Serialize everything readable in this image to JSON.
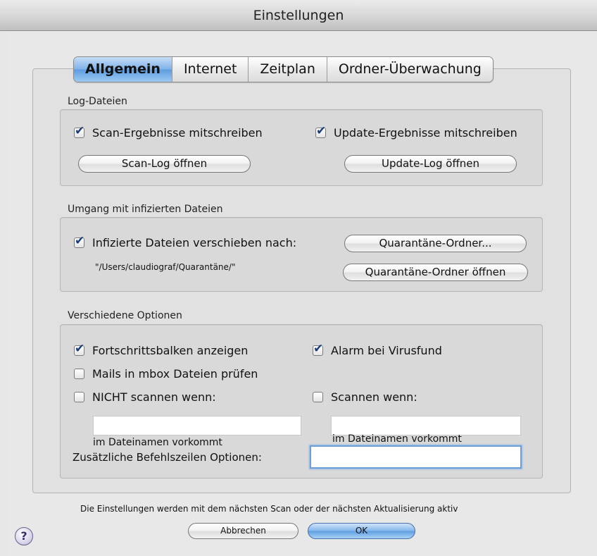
{
  "window": {
    "title": "Einstellungen"
  },
  "tabs": [
    {
      "label": "Allgemein",
      "selected": true
    },
    {
      "label": "Internet",
      "selected": false
    },
    {
      "label": "Zeitplan",
      "selected": false
    },
    {
      "label": "Ordner-Überwachung",
      "selected": false
    }
  ],
  "log": {
    "group_label": "Log-Dateien",
    "scan_results": {
      "label": "Scan-Ergebnisse mitschreiben",
      "checked": true
    },
    "update_results": {
      "label": "Update-Ergebnisse mitschreiben",
      "checked": true
    },
    "open_scan_log": "Scan-Log öffnen",
    "open_update_log": "Update-Log öffnen"
  },
  "infected": {
    "group_label": "Umgang mit infizierten Dateien",
    "move": {
      "label": "Infizierte Dateien verschieben nach:",
      "checked": true
    },
    "path": "\"/Users/claudiograf/Quarantäne/\"",
    "quarantine_folder_button": "Quarantäne-Ordner...",
    "open_quarantine_button": "Quarantäne-Ordner öffnen"
  },
  "options": {
    "group_label": "Verschiedene Optionen",
    "progress_bar": {
      "label": "Fortschrittsbalken anzeigen",
      "checked": true
    },
    "virus_alarm": {
      "label": "Alarm bei Virusfund",
      "checked": true
    },
    "mbox": {
      "label": "Mails in mbox Dateien prüfen",
      "checked": false
    },
    "not_scan_if": {
      "label": "NICHT scannen wenn:",
      "checked": false
    },
    "scan_if": {
      "label": "Scannen wenn:",
      "checked": false
    },
    "not_scan_value": "",
    "scan_value": "",
    "in_filename_left": "im Dateinamen vorkommt",
    "in_filename_right": "im Dateinamen vorkommt",
    "extra_options_label": "Zusätzliche Befehlszeilen Optionen:",
    "extra_options_value": ""
  },
  "footer": {
    "note": "Die Einstellungen werden mit dem nächsten Scan oder der nächsten Aktualisierung aktiv",
    "cancel": "Abbrechen",
    "ok": "OK",
    "help": "?"
  },
  "colors": {
    "accent": "#5c9ce0",
    "checkmark": "#1b3c7a"
  }
}
